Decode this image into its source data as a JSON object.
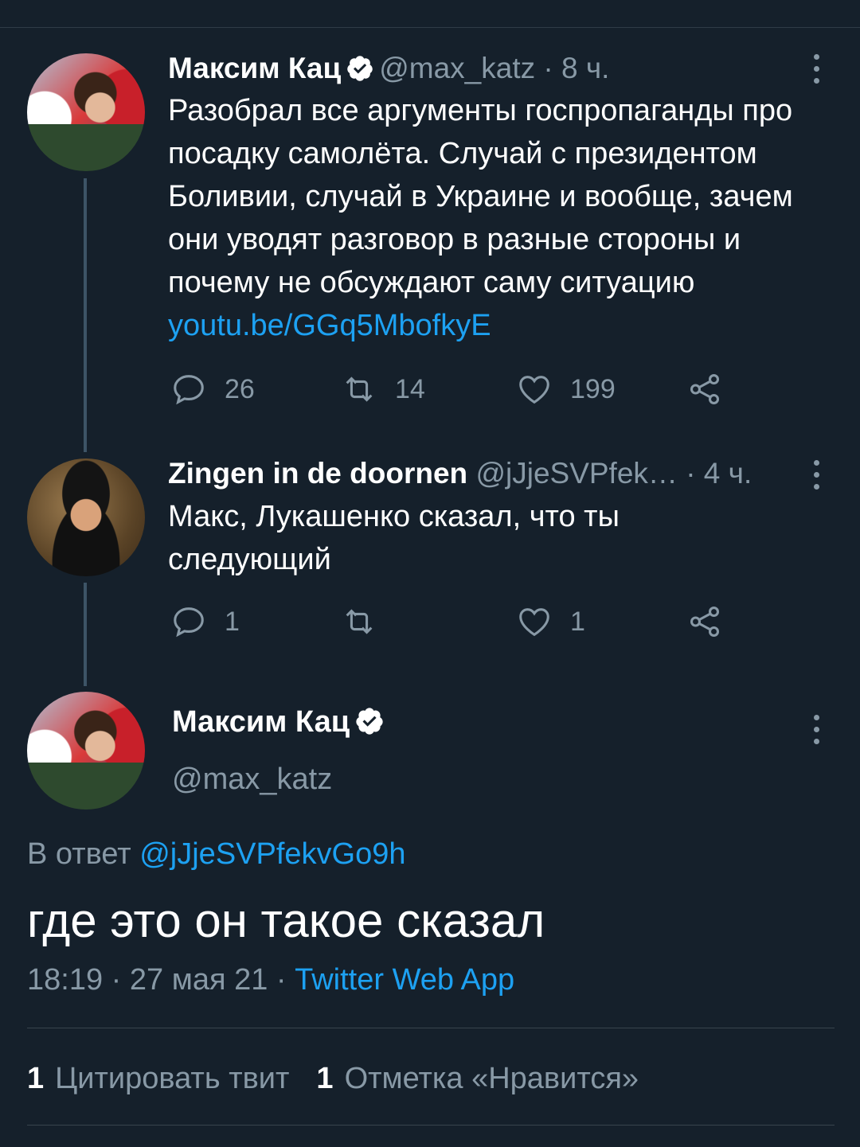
{
  "tweet1": {
    "name": "Максим Кац",
    "handle": "@max_katz",
    "time": "· 8 ч.",
    "text": "Разобрал все аргументы госпропаганды про посадку самолёта. Случай с президентом Боливии, случай в Украине и вообще, зачем они уводят разговор в разные стороны и почему не обсуждают саму ситуацию",
    "link": "youtu.be/GGq5MbofkyE",
    "replies": "26",
    "retweets": "14",
    "likes": "199"
  },
  "tweet2": {
    "name": "Zingen in de doornen",
    "handle": "@jJjeSVPfek…",
    "time": "· 4 ч.",
    "text_line1": "Макс, Лукашенко сказал, что ты",
    "text_line2": "следующий",
    "replies": "1",
    "retweets": "",
    "likes": "1"
  },
  "main_tweet": {
    "name": "Максим Кац",
    "handle": "@max_katz",
    "reply_prefix": "В ответ",
    "reply_handle": "@jJjeSVPfekvGo9h",
    "text": "где это он такое сказал",
    "timestamp": "18:19 · 27 мая 21 ·",
    "source": "Twitter Web App",
    "quote_count": "1",
    "quote_label": "Цитировать твит",
    "like_count": "1",
    "like_label": "Отметка «Нравится»"
  },
  "colors": {
    "background": "#15202b",
    "muted": "#8899a6",
    "link": "#1da1f2",
    "verified": "#ffffff"
  },
  "icons": [
    "reply-icon",
    "retweet-icon",
    "like-icon",
    "share-icon",
    "verified-icon",
    "more-icon"
  ]
}
